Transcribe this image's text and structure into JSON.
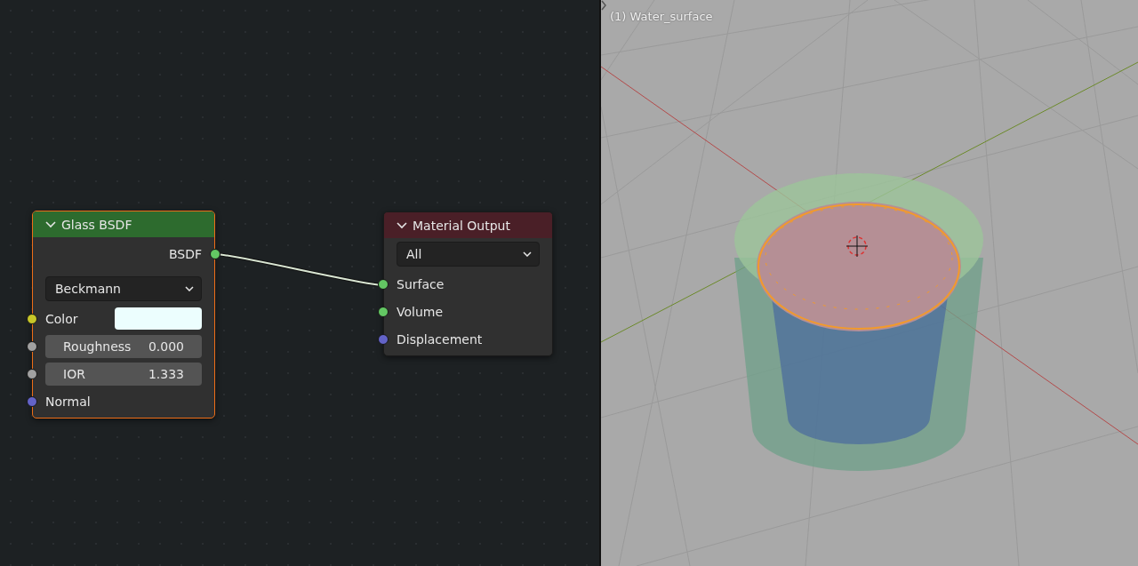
{
  "node_editor": {
    "nodes": [
      {
        "title": "Glass BSDF",
        "color": "#2d6b2e",
        "selected": true,
        "expanded": true,
        "outputs": [
          {
            "label": "BSDF",
            "color": "#63c763"
          }
        ],
        "inputs": [
          {
            "kind": "dropdown",
            "value": "Beckmann"
          },
          {
            "kind": "color",
            "label": "Color",
            "color": "#c7c729"
          },
          {
            "kind": "number",
            "label": "Roughness",
            "value": "0.000",
            "color": "#a1a1a1"
          },
          {
            "kind": "number",
            "label": "IOR",
            "value": "1.333",
            "color": "#a1a1a1"
          },
          {
            "kind": "socket",
            "label": "Normal",
            "color": "#6363c7"
          }
        ]
      },
      {
        "title": "Material Output",
        "color": "#4a1f27",
        "selected": false,
        "expanded": true,
        "inputs": [
          {
            "kind": "dropdown",
            "value": "All"
          },
          {
            "kind": "socket",
            "label": "Surface",
            "color": "#63c763"
          },
          {
            "kind": "socket",
            "label": "Volume",
            "color": "#63c763"
          },
          {
            "kind": "socket",
            "label": "Displacement",
            "color": "#6363c7"
          }
        ]
      }
    ]
  },
  "viewport": {
    "object_label": "(1) Water_surface"
  }
}
